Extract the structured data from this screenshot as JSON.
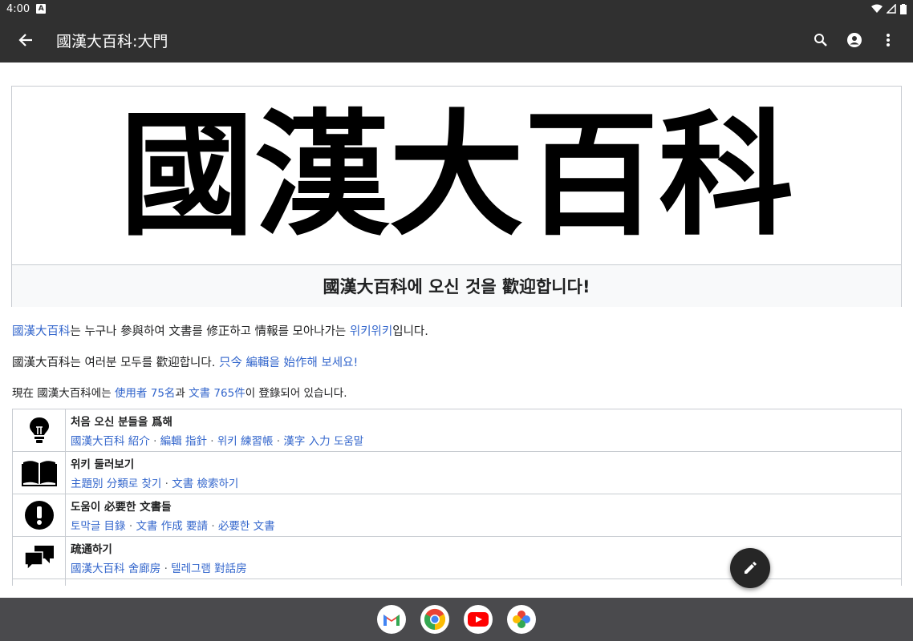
{
  "status_bar": {
    "time": "4:00",
    "badge": "A"
  },
  "app_bar": {
    "title": "國漢大百科:大門"
  },
  "banner": {
    "logo": "國漢大百科",
    "welcome": "國漢大百科에 오신 것을 歡迎합니다!"
  },
  "intro": {
    "p1": {
      "link1": "國漢大百科",
      "text1": "는 누구나 參與하여 文書를 修正하고 情報를 모아나가는 ",
      "link2": "위키위키",
      "text2": "입니다."
    },
    "p2": {
      "text1": "國漢大百科는 여러분 모두를 歡迎합니다. ",
      "link1": "只今 編輯을 始作해 보세요!"
    },
    "p3": {
      "text1": "現在 國漢大百科에는 ",
      "link1": "使用者 75名",
      "text2": "과 ",
      "link2": "文書 765件",
      "text3": "이 登錄되어 있습니다."
    }
  },
  "portal": [
    {
      "icon": "lightbulb-icon",
      "heading": "처음 오신 분들을 爲해",
      "links": [
        "國漢大百科 紹介",
        "編輯 指針",
        "위키 練習帳",
        "漢字 入力 도움말"
      ]
    },
    {
      "icon": "book-icon",
      "heading": "위키 둘러보기",
      "links": [
        "主題別 分類로 찾기",
        "文書 檢索하기"
      ]
    },
    {
      "icon": "exclamation-icon",
      "heading": "도움이 必要한 文書들",
      "links": [
        "토막글 目錄",
        "文書 作成 要請",
        "必要한 文書"
      ]
    },
    {
      "icon": "chat-icon",
      "heading": "疏通하기",
      "links": [
        "國漢大百科 舍廊房",
        "텔레그램 對話房"
      ]
    }
  ],
  "colors": {
    "link": "#3366cc",
    "appbar": "#303030",
    "taskbar": "#4a4a4d"
  },
  "taskbar_apps": [
    "gmail-icon",
    "chrome-icon",
    "youtube-icon",
    "photos-icon"
  ]
}
